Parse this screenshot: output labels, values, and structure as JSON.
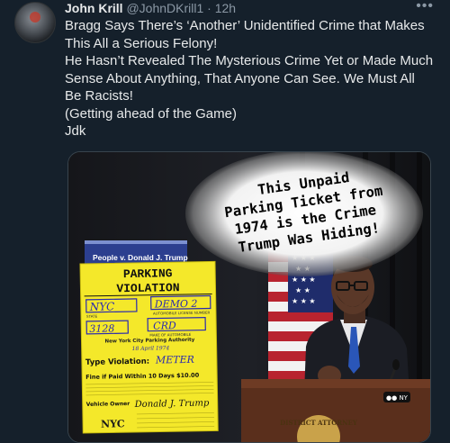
{
  "author": {
    "name": "John Krill",
    "handle": "@JohnDKrill1",
    "separator": "·",
    "time": "12h"
  },
  "more_icon": "more-horizontal-icon",
  "tweet_text": "Bragg Says There’s ‘Another’ Unidentified Crime that Makes This All a Serious Felony!\nHe Hasn’t Revealed The Mysterious Crime Yet or Made Much Sense About Anything, That Anyone Can See. We Must All Be Racists!\n (Getting ahead of the Game)\nJdk",
  "media": {
    "meme_caption": [
      "This Unpaid",
      "Parking Ticket from",
      "1974 is the Crime",
      "Trump Was Hiding!"
    ],
    "banner": "People v. Donald J. Trump",
    "ticket": {
      "title_line1": "PARKING",
      "title_line2": "VIOLATION",
      "state": "NYC",
      "plate": "DEMO 2",
      "field_state_label": "STATE",
      "field_plate_label": "AUTOMOBILE LICENSE NUMBER",
      "number": "3128",
      "make": "CRD",
      "make_label": "MAKE OF AUTOMOBILE",
      "authority": "New York City Parking Authority",
      "date": "18 April 1974",
      "type_label": "Type Violation:",
      "type_value": "METER",
      "fine_text": "Fine if Paid Within 10 Days $10.00",
      "owner_label": "Vehicle Owner",
      "owner_signature": "Donald J. Trump",
      "logo": "NYC"
    },
    "podium_seal": "DISTRICT ATTORNEY",
    "colors": {
      "ticket_yellow": "#f4e82a",
      "ticket_ink": "#2a2ab0",
      "banner_blue": "#2c3f8f",
      "background": "#0d0d0f"
    }
  }
}
